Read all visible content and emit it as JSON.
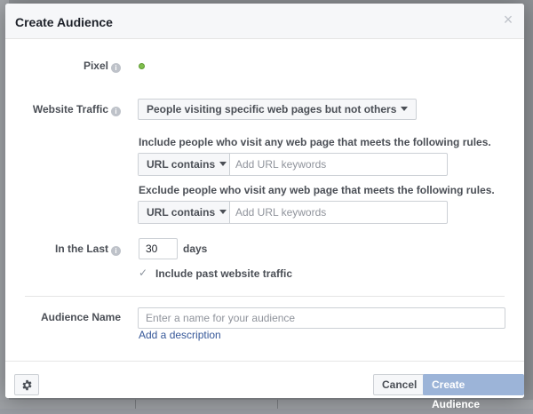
{
  "modal": {
    "title": "Create Audience",
    "close_glyph": "×"
  },
  "pixel": {
    "label": "Pixel",
    "status_color": "#7fbf4d"
  },
  "website_traffic": {
    "label": "Website Traffic",
    "selected": "People visiting specific web pages but not others"
  },
  "include_rule": {
    "text": "Include people who visit any web page that meets the following rules.",
    "operator": "URL contains",
    "placeholder": "Add URL keywords"
  },
  "exclude_rule": {
    "text": "Exclude people who visit any web page that meets the following rules.",
    "operator": "URL contains",
    "placeholder": "Add URL keywords"
  },
  "in_the_last": {
    "label": "In the Last",
    "value": "30",
    "unit": "days"
  },
  "past_traffic": {
    "label": "Include past website traffic",
    "checked": true
  },
  "audience_name": {
    "label": "Audience Name",
    "placeholder": "Enter a name for your audience",
    "add_description": "Add a description"
  },
  "footer": {
    "cancel": "Cancel",
    "create": "Create Audience"
  },
  "colors": {
    "link": "#365899",
    "primary_disabled": "#9cb4d8"
  }
}
